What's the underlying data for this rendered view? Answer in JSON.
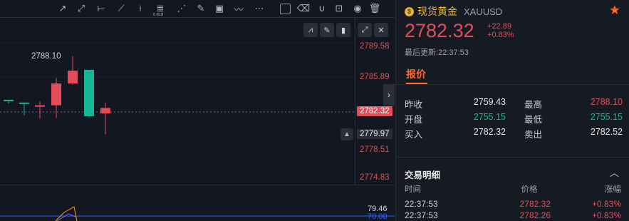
{
  "toolbar": {
    "tools": [
      {
        "name": "trend-line-icon",
        "glyph": "↗"
      },
      {
        "name": "ray-icon",
        "glyph": "⤢"
      },
      {
        "name": "horizontal-line-icon",
        "glyph": "⟝"
      },
      {
        "name": "segment-icon",
        "glyph": "⟋"
      },
      {
        "name": "extended-line-icon",
        "glyph": "⟊"
      },
      {
        "name": "fibonacci-icon",
        "glyph": "≣",
        "label": "0.618"
      },
      {
        "name": "gann-fan-icon",
        "glyph": "⋰"
      },
      {
        "name": "brush-icon",
        "glyph": "✎"
      },
      {
        "name": "image-icon",
        "glyph": "▣"
      },
      {
        "name": "path-icon",
        "glyph": "〰"
      },
      {
        "name": "more-icon",
        "glyph": "⋯"
      },
      {
        "name": "edit-icon",
        "glyph": "✎",
        "active": true
      },
      {
        "name": "eraser-icon",
        "glyph": "⌫"
      },
      {
        "name": "magnet-icon",
        "glyph": "∪"
      },
      {
        "name": "unlock-icon",
        "glyph": "⊡"
      },
      {
        "name": "eye-icon",
        "glyph": "◉"
      },
      {
        "name": "trash-icon",
        "glyph": "🗑"
      }
    ]
  },
  "chart": {
    "high_marker": "2788.10",
    "price_axis": [
      "2789.58",
      "2785.89",
      "2782.32",
      "2779.97",
      "2778.51",
      "2774.83"
    ],
    "current_price": "2782.32",
    "sub_values": [
      "79.46",
      "70.00"
    ]
  },
  "chart_data": {
    "type": "candlestick",
    "ylim": [
      2774.83,
      2789.58
    ],
    "candles": [
      {
        "o": 2783.2,
        "h": 2783.3,
        "l": 2782.9,
        "c": 2783.3,
        "dir": "up"
      },
      {
        "o": 2782.9,
        "h": 2783.0,
        "l": 2781.6,
        "c": 2783.0,
        "dir": "up"
      },
      {
        "o": 2782.7,
        "h": 2783.1,
        "l": 2781.2,
        "c": 2782.7,
        "dir": "down"
      },
      {
        "o": 2782.7,
        "h": 2785.7,
        "l": 2781.3,
        "c": 2785.1,
        "dir": "up"
      },
      {
        "o": 2785.1,
        "h": 2788.1,
        "l": 2785.0,
        "c": 2786.5,
        "dir": "up"
      },
      {
        "o": 2786.6,
        "h": 2786.6,
        "l": 2781.4,
        "c": 2781.5,
        "dir": "down"
      },
      {
        "o": 2782.4,
        "h": 2783.0,
        "l": 2779.5,
        "c": 2781.8,
        "dir": "up"
      }
    ]
  },
  "quote": {
    "name": "现货黄金",
    "code": "XAUUSD",
    "price": "2782.32",
    "change": "+22.89",
    "change_pct": "+0.83%",
    "updated": "最后更新:22:37:53",
    "tab_label": "报价",
    "stats": [
      {
        "l1": "昨收",
        "v1": "2759.43",
        "c1": "",
        "l2": "最高",
        "v2": "2788.10",
        "c2": "up"
      },
      {
        "l1": "开盘",
        "v1": "2755.15",
        "c1": "down",
        "l2": "最低",
        "v2": "2755.15",
        "c2": "down"
      },
      {
        "l1": "买入",
        "v1": "2782.32",
        "c1": "",
        "l2": "卖出",
        "v2": "2782.52",
        "c2": ""
      }
    ]
  },
  "trades": {
    "title": "交易明细",
    "headers": [
      "时间",
      "价格",
      "涨幅"
    ],
    "rows": [
      {
        "time": "22:37:53",
        "price": "2782.32",
        "pct": "+0.83%"
      },
      {
        "time": "22:37:53",
        "price": "2782.26",
        "pct": "+0.83%"
      }
    ]
  },
  "colors": {
    "up": "#e34d59",
    "down": "#18b597",
    "accent": "#ff6a2b"
  }
}
